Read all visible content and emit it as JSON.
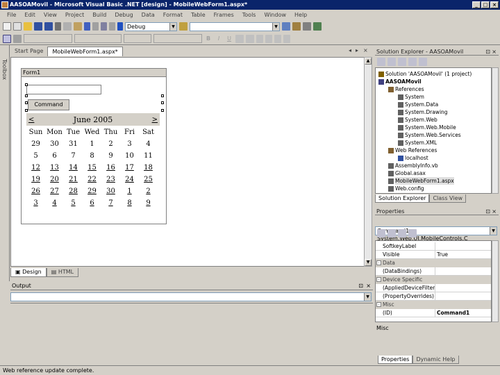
{
  "window": {
    "title": "AASOAMovil - Microsoft Visual Basic .NET [design] - MobileWebForm1.aspx*",
    "min": "_",
    "max": "□",
    "close": "×"
  },
  "menu": [
    "File",
    "Edit",
    "View",
    "Project",
    "Build",
    "Debug",
    "Data",
    "Format",
    "Table",
    "Frames",
    "Tools",
    "Window",
    "Help"
  ],
  "toolbar": {
    "config": "Debug"
  },
  "toolbox_label": "Toolbox",
  "doc_tabs": [
    "Start Page",
    "MobileWebForm1.aspx*"
  ],
  "doc_tab_controls": {
    "prev": "◂",
    "next": "▸",
    "close": "×"
  },
  "form": {
    "header": "Form1",
    "command_button": "Command",
    "calendar": {
      "prev": "<",
      "next": ">",
      "month": "June 2005",
      "days_of_week": [
        "Sun",
        "Mon",
        "Tue",
        "Wed",
        "Thu",
        "Fri",
        "Sat"
      ],
      "weeks": [
        [
          "29",
          "30",
          "31",
          "1",
          "2",
          "3",
          "4"
        ],
        [
          "5",
          "6",
          "7",
          "8",
          "9",
          "10",
          "11"
        ],
        [
          "12",
          "13",
          "14",
          "15",
          "16",
          "17",
          "18"
        ],
        [
          "19",
          "20",
          "21",
          "22",
          "23",
          "24",
          "25"
        ],
        [
          "26",
          "27",
          "28",
          "29",
          "30",
          "1",
          "2"
        ],
        [
          "3",
          "4",
          "5",
          "6",
          "7",
          "8",
          "9"
        ]
      ]
    }
  },
  "design_tabs": [
    "Design",
    "HTML"
  ],
  "output": {
    "title": "Output"
  },
  "status": "Web reference update complete.",
  "solution_explorer": {
    "title": "Solution Explorer - AASOAMovil",
    "items": [
      {
        "label": "Solution 'AASOAMovil' (1 project)",
        "level": 0,
        "color": "#806000"
      },
      {
        "label": "AASOAMovil",
        "level": 0,
        "color": "#404080",
        "bold": true
      },
      {
        "label": "References",
        "level": 1,
        "color": "#806030"
      },
      {
        "label": "System",
        "level": 2,
        "color": "#606060"
      },
      {
        "label": "System.Data",
        "level": 2,
        "color": "#606060"
      },
      {
        "label": "System.Drawing",
        "level": 2,
        "color": "#606060"
      },
      {
        "label": "System.Web",
        "level": 2,
        "color": "#606060"
      },
      {
        "label": "System.Web.Mobile",
        "level": 2,
        "color": "#606060"
      },
      {
        "label": "System.Web.Services",
        "level": 2,
        "color": "#606060"
      },
      {
        "label": "System.XML",
        "level": 2,
        "color": "#606060"
      },
      {
        "label": "Web References",
        "level": 1,
        "color": "#806030"
      },
      {
        "label": "localhost",
        "level": 2,
        "color": "#3050a0"
      },
      {
        "label": "AssemblyInfo.vb",
        "level": 1,
        "color": "#606060"
      },
      {
        "label": "Global.asax",
        "level": 1,
        "color": "#606060"
      },
      {
        "label": "MobileWebForm1.aspx",
        "level": 1,
        "color": "#606060",
        "selected": true
      },
      {
        "label": "Web.config",
        "level": 1,
        "color": "#606060"
      }
    ],
    "tabs": [
      "Solution Explorer",
      "Class View"
    ]
  },
  "properties": {
    "title": "Properties",
    "object": "Command1 System.Web.UI.MobileControls.C",
    "rows": [
      {
        "name": "SoftkeyLabel",
        "value": "",
        "type": "row"
      },
      {
        "name": "Visible",
        "value": "True",
        "type": "row"
      },
      {
        "name": "Data",
        "type": "cat"
      },
      {
        "name": "(DataBindings)",
        "value": "",
        "type": "row"
      },
      {
        "name": "Device Specific",
        "type": "cat"
      },
      {
        "name": "(AppliedDeviceFilters)",
        "value": "",
        "type": "row"
      },
      {
        "name": "(PropertyOverrides)",
        "value": "",
        "type": "row"
      },
      {
        "name": "Misc",
        "type": "cat"
      },
      {
        "name": "(ID)",
        "value": "Command1",
        "type": "row",
        "boldval": true
      }
    ],
    "description": "Misc",
    "tabs": [
      "Properties",
      "Dynamic Help"
    ]
  }
}
